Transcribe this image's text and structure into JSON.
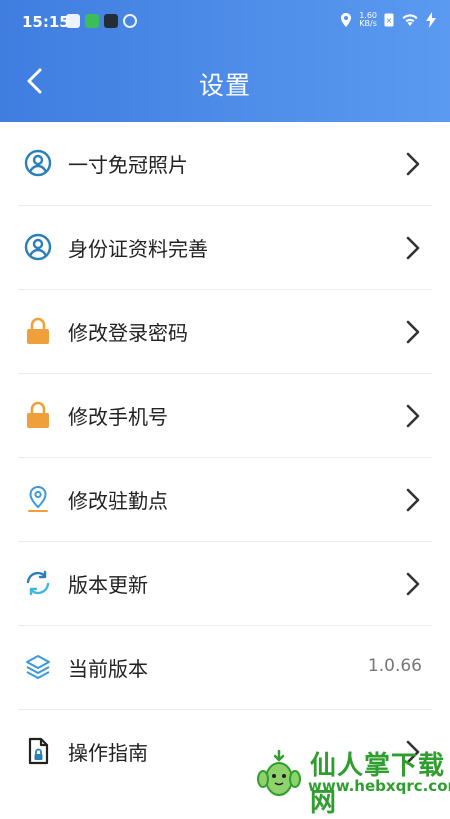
{
  "status_bar": {
    "time": "15:15",
    "speed_value": "1.60",
    "speed_unit": "KB/s"
  },
  "nav": {
    "title": "设置"
  },
  "items": [
    {
      "label": "一寸免冠照片",
      "icon": "user-circle-icon"
    },
    {
      "label": "身份证资料完善",
      "icon": "user-circle-icon"
    },
    {
      "label": "修改登录密码",
      "icon": "lock-icon"
    },
    {
      "label": "修改手机号",
      "icon": "lock-icon"
    },
    {
      "label": "修改驻勤点",
      "icon": "location-pin-icon"
    },
    {
      "label": "版本更新",
      "icon": "refresh-icon"
    },
    {
      "label": "当前版本",
      "icon": "layers-icon",
      "value": "1.0.66"
    },
    {
      "label": "操作指南",
      "icon": "document-lock-icon"
    }
  ],
  "watermark": {
    "title": "仙人掌下载网",
    "url": "www.hebxqrc.com"
  },
  "colors": {
    "header_start": "#3f7de0",
    "header_end": "#5b9af0",
    "icon_blue": "#2a7fb8",
    "icon_orange": "#f0a03a"
  }
}
